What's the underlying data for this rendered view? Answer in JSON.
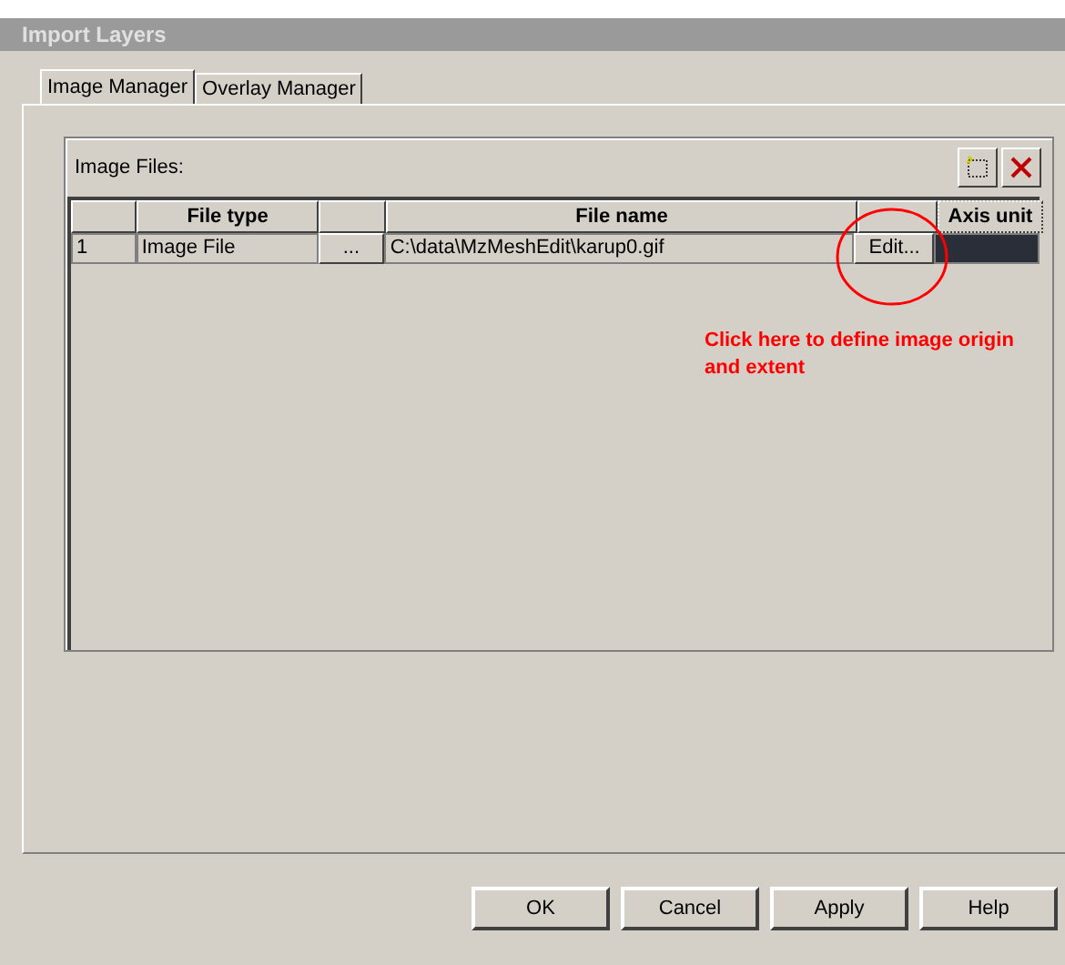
{
  "window": {
    "title": "Import Layers"
  },
  "tabs": [
    {
      "label": "Image Manager",
      "selected": true
    },
    {
      "label": "Overlay Manager",
      "selected": false
    }
  ],
  "group": {
    "label": "Image Files:"
  },
  "table": {
    "columns": [
      "",
      "File type",
      "",
      "File name",
      "",
      "Axis unit"
    ],
    "rows": [
      {
        "number": "1",
        "file_type": "Image File",
        "browse": "...",
        "file_name": "C:\\data\\MzMeshEdit\\karup0.gif",
        "edit": "Edit...",
        "selected": true
      }
    ]
  },
  "annotation": "Click here to define image origin and extent",
  "buttons": [
    "OK",
    "Cancel",
    "Apply",
    "Help"
  ]
}
